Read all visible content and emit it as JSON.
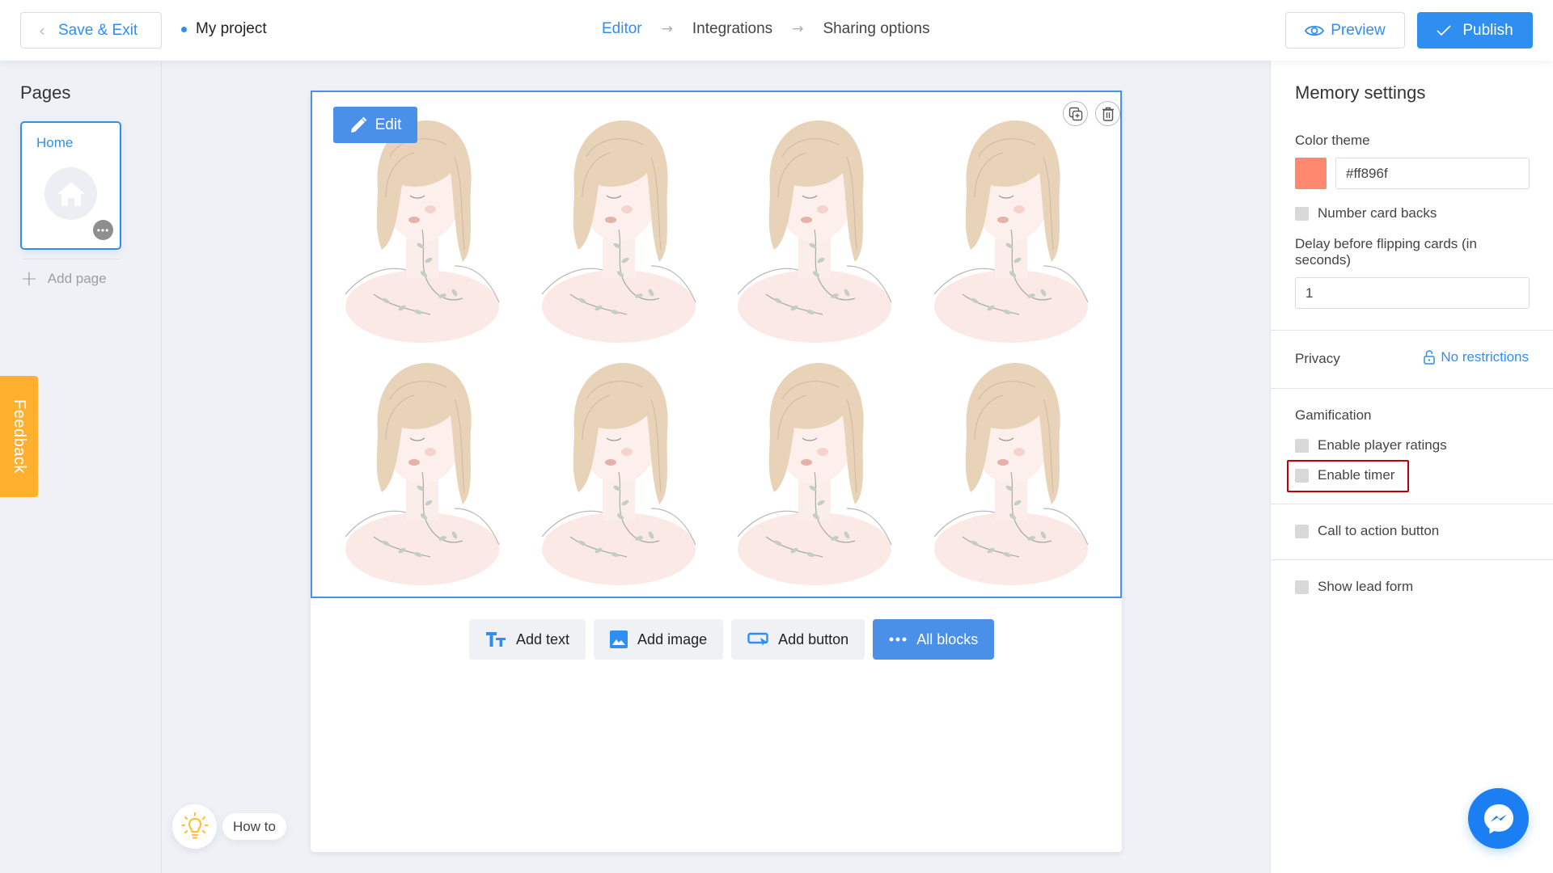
{
  "header": {
    "save_exit_label": "Save & Exit",
    "project_name": "My project",
    "steps": [
      {
        "label": "Editor",
        "active": true
      },
      {
        "label": "Integrations",
        "active": false
      },
      {
        "label": "Sharing options",
        "active": false
      }
    ],
    "preview_label": "Preview",
    "publish_label": "Publish"
  },
  "sidebar": {
    "title": "Pages",
    "pages": [
      {
        "name": "Home"
      }
    ],
    "add_page_label": "Add page",
    "feedback_label": "Feedback",
    "howto_label": "How to"
  },
  "canvas": {
    "edit_label": "Edit",
    "card_count": 8,
    "toolbar": [
      {
        "label": "Add text",
        "icon": "text-icon"
      },
      {
        "label": "Add image",
        "icon": "image-icon"
      },
      {
        "label": "Add button",
        "icon": "button-icon"
      },
      {
        "label": "All blocks",
        "icon": "more-dots-icon"
      }
    ]
  },
  "settings": {
    "title": "Memory settings",
    "color_theme_label": "Color theme",
    "color_theme_value": "#ff896f",
    "number_card_backs_label": "Number card backs",
    "number_card_backs_checked": false,
    "delay_label": "Delay before flipping cards (in seconds)",
    "delay_value": "1",
    "privacy_label": "Privacy",
    "privacy_value": "No restrictions",
    "gamification_label": "Gamification",
    "enable_player_ratings_label": "Enable player ratings",
    "enable_player_ratings_checked": false,
    "enable_timer_label": "Enable timer",
    "enable_timer_checked": false,
    "cta_label": "Call to action button",
    "cta_checked": false,
    "lead_form_label": "Show lead form",
    "lead_form_checked": false
  },
  "colors": {
    "accent": "#2f8ff0",
    "edit_blue": "#4a90e8",
    "feedback": "#ffb02e",
    "theme_swatch": "#ff896f",
    "highlight": "#c00000",
    "messenger": "#1b7ef2"
  }
}
